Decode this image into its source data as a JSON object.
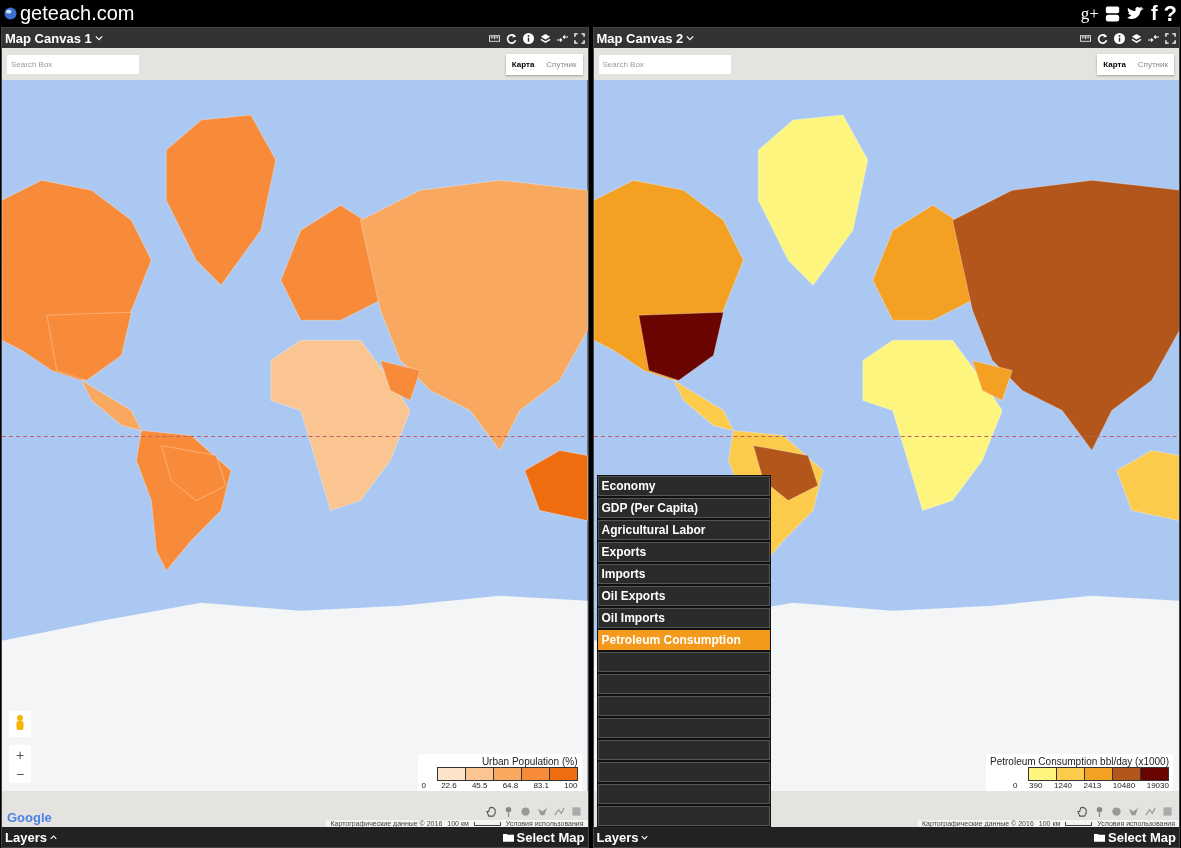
{
  "header": {
    "site": "geteach.com",
    "social": {
      "google_plus": "g+",
      "facebook": "f",
      "help": "?"
    }
  },
  "panels": [
    {
      "title": "Map Canvas 1",
      "search": {
        "placeholder": "Search Box"
      },
      "map_types": [
        {
          "label": "Карта",
          "selected": true
        },
        {
          "label": "Спутник",
          "selected": false
        }
      ],
      "legend": {
        "title": "Urban Population (%)",
        "bins": [
          {
            "color": "#fde3c8"
          },
          {
            "color": "#fbc592"
          },
          {
            "color": "#f9a860"
          },
          {
            "color": "#f78b3a"
          },
          {
            "color": "#ef6d0e"
          }
        ],
        "ticks": [
          "0",
          "22.6",
          "45.5",
          "64.8",
          "83.1",
          "100"
        ]
      },
      "zoom_controls": {
        "zoom_in": "+",
        "zoom_out": "−"
      },
      "logo": "Google",
      "attribution": "Картографические данные © 2016",
      "scale": "100 км",
      "terms": "Условия использования",
      "layers": {
        "label": "Layers",
        "expanded": false
      },
      "select_map": "Select Map"
    },
    {
      "title": "Map Canvas 2",
      "search": {
        "placeholder": "Search Box"
      },
      "map_types": [
        {
          "label": "Карта",
          "selected": true
        },
        {
          "label": "Спутник",
          "selected": false
        }
      ],
      "legend": {
        "title": "Petroleum Consumption bbl/day (x1000)",
        "bins": [
          {
            "color": "#fdf57e"
          },
          {
            "color": "#fccb4c"
          },
          {
            "color": "#f3a023"
          },
          {
            "color": "#b2561b"
          },
          {
            "color": "#6a0401"
          }
        ],
        "ticks": [
          "0",
          "390",
          "1240",
          "2413",
          "10480",
          "19030"
        ]
      },
      "attribution": "Картографические данные © 2016",
      "scale": "100 км",
      "terms": "Условия использования",
      "layers": {
        "label": "Layers",
        "expanded": true
      },
      "select_map": "Select Map",
      "layer_menu": [
        {
          "label": "Economy",
          "selected": false
        },
        {
          "label": "GDP (Per Capita)",
          "selected": false
        },
        {
          "label": "Agricultural Labor",
          "selected": false
        },
        {
          "label": "Exports",
          "selected": false
        },
        {
          "label": "Imports",
          "selected": false
        },
        {
          "label": "Oil Exports",
          "selected": false
        },
        {
          "label": "Oil Imports",
          "selected": false
        },
        {
          "label": "Petroleum Consumption",
          "selected": true
        }
      ]
    }
  ]
}
